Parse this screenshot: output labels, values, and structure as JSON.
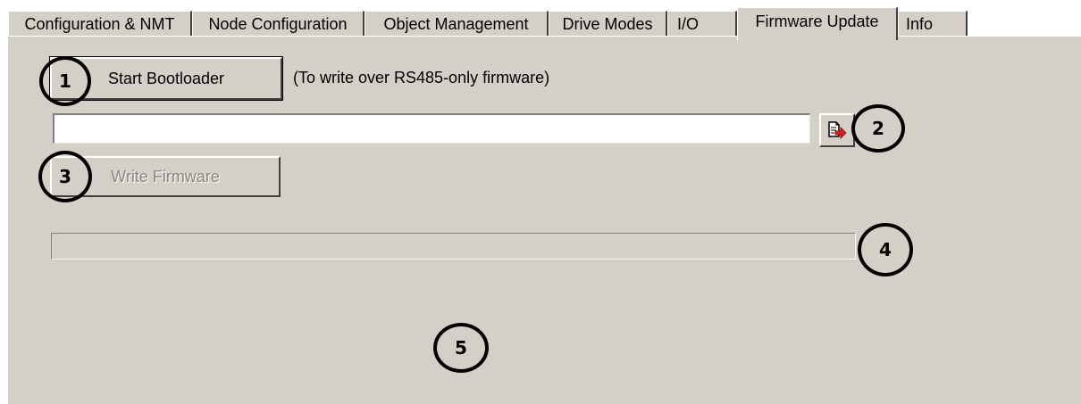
{
  "tabs": [
    {
      "label": "Configuration & NMT",
      "active": false
    },
    {
      "label": "Node Configuration",
      "active": false
    },
    {
      "label": "Object Management",
      "active": false
    },
    {
      "label": "Drive Modes",
      "active": false
    },
    {
      "label": "I/O",
      "active": false
    },
    {
      "label": "Firmware Update",
      "active": true
    },
    {
      "label": "Info",
      "active": false
    }
  ],
  "firmware": {
    "start_bootloader_label": "Start Bootloader",
    "bootloader_note": "(To write over RS485-only firmware)",
    "file_path_value": "",
    "browse_icon": "open-file-arrow-icon",
    "write_firmware_label": "Write Firmware",
    "write_firmware_enabled": false,
    "progress_fraction": 0
  },
  "callouts": [
    "1",
    "2",
    "3",
    "4",
    "5"
  ],
  "colors": {
    "panel": "#d4d0c8",
    "arrow": "#e02020",
    "callout_ring": "#000000"
  }
}
